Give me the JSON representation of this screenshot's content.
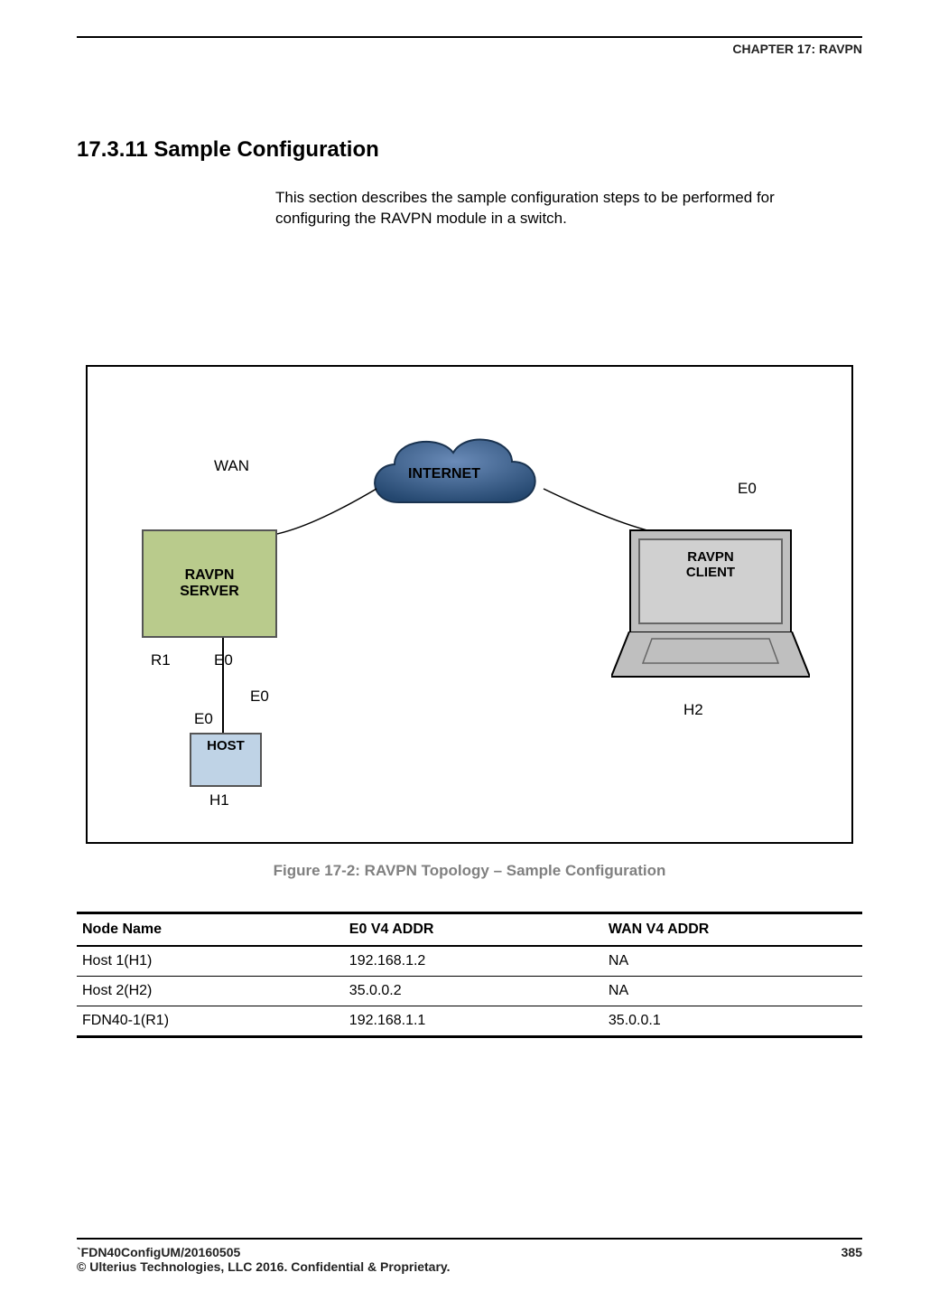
{
  "header": {
    "chapter": "CHAPTER 17: RAVPN"
  },
  "section": {
    "number": "17.3.11",
    "title": "Sample Configuration",
    "heading": "17.3.11 Sample Configuration",
    "body": "This section describes the sample configuration steps to be performed for configuring the RAVPN module in a switch."
  },
  "diagram": {
    "cloud_label": "INTERNET",
    "server_label": "RAVPN\nSERVER",
    "client_label": "RAVPN\nCLIENT",
    "host_label": "HOST",
    "labels": {
      "wan": "WAN",
      "e0_right": "E0",
      "r1": "R1",
      "e0_below_server": "E0",
      "e0_mid": "E0",
      "e0_host": "E0",
      "h1": "H1",
      "h2": "H2"
    }
  },
  "figure_caption": "Figure 17-2: RAVPN Topology – Sample Configuration",
  "table": {
    "headers": [
      "Node Name",
      "E0 V4 ADDR",
      "WAN V4 ADDR"
    ],
    "rows": [
      {
        "node": "Host 1(H1)",
        "e0": "192.168.1.2",
        "wan": "NA"
      },
      {
        "node": "Host 2(H2)",
        "e0": "35.0.0.2",
        "wan": "NA"
      },
      {
        "node": "FDN40-1(R1)",
        "e0": "192.168.1.1",
        "wan": "35.0.0.1"
      }
    ]
  },
  "footer": {
    "doc_id": "`FDN40ConfigUM/20160505",
    "copyright": "© Ulterius Technologies, LLC 2016. Confidential & Proprietary.",
    "page": "385"
  }
}
